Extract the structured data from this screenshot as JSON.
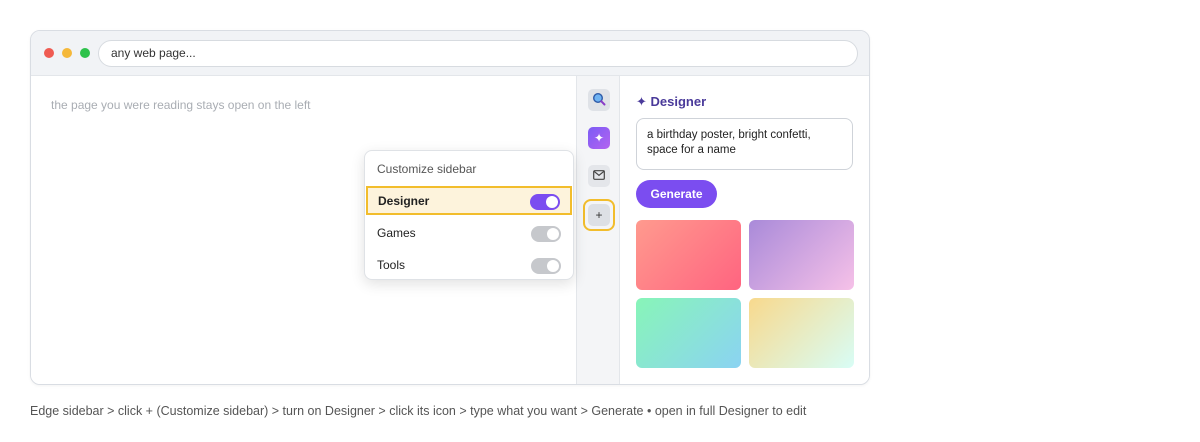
{
  "browser": {
    "address": "any web page..."
  },
  "page": {
    "note": "the page you were reading stays open on the left"
  },
  "rail": {
    "items": [
      {
        "icon": "search-icon",
        "glyph": "🔍"
      },
      {
        "icon": "designer-sparkle-icon",
        "glyph": "✦"
      },
      {
        "icon": "mail-icon",
        "glyph": "✉"
      },
      {
        "icon": "plus-icon",
        "glyph": "+"
      }
    ]
  },
  "designer_panel": {
    "title": "✦ Designer",
    "prompt": "a birthday poster, bright confetti, space for a name",
    "generate_label": "Generate"
  },
  "customize_menu": {
    "header": "Customize sidebar",
    "items": [
      {
        "label": "Designer",
        "on": true
      },
      {
        "label": "Games",
        "on": false
      },
      {
        "label": "Tools",
        "on": false
      }
    ]
  },
  "caption": "Edge sidebar > click + (Customize sidebar) > turn on Designer > click its icon > type what you want > Generate  •  open in full Designer to edit",
  "colors": {
    "accent": "#7b4df0",
    "highlight": "#f2bd2c",
    "highlight_bg": "#fdf3dc"
  }
}
